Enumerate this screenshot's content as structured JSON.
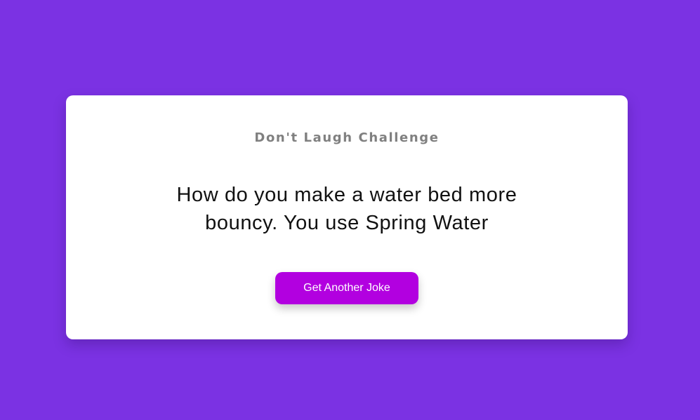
{
  "colors": {
    "background": "#7b32e3",
    "card": "#ffffff",
    "button": "#b200e0"
  },
  "card": {
    "title": "Don't Laugh Challenge",
    "joke": "How do you make a water bed more bouncy. You use Spring Water",
    "button_label": "Get Another Joke"
  }
}
